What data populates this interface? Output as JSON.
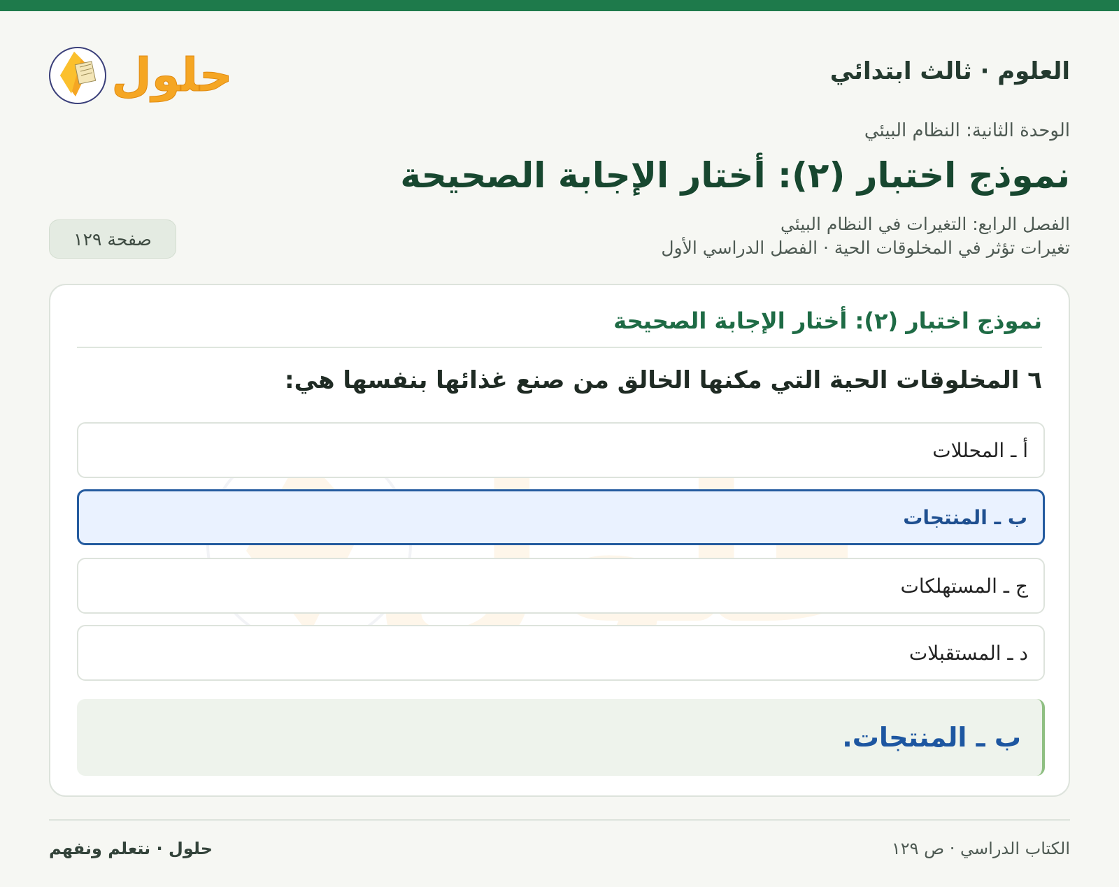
{
  "header": {
    "subject": "العلوم · ثالث ابتدائي",
    "logo_text": "حلول"
  },
  "unit": "الوحدة الثانية: النظام البيئي",
  "page_title": "نموذج اختبار (٢): أختار الإجابة الصحيحة",
  "chapter": "الفصل الرابع: التغيرات في النظام البيئي",
  "lesson": "تغيرات تؤثر في المخلوقات الحية · الفصل الدراسي الأول",
  "page_badge": "صفحة ١٢٩",
  "card": {
    "title": "نموذج اختبار (٢): أختار الإجابة الصحيحة",
    "question": "٦ المخلوقات الحية التي مكنها الخالق من صنع غذائها بنفسها هي:",
    "options": [
      {
        "label": "أ ـ المحللات",
        "selected": false
      },
      {
        "label": "ب ـ المنتجات",
        "selected": true
      },
      {
        "label": "ج ـ المستهلكات",
        "selected": false
      },
      {
        "label": "د ـ المستقبلات",
        "selected": false
      }
    ],
    "answer": "ب ـ المنتجات."
  },
  "footer": {
    "right": "الكتاب الدراسي · ص ١٢٩",
    "left": "حلول · نتعلم ونفهم"
  },
  "colors": {
    "accent": "#1e7a4b",
    "selected_border": "#245b9f",
    "answer_text": "#1d56a1",
    "logo_orange": "#f5a623"
  },
  "icons": {
    "logo": "book-icon"
  }
}
